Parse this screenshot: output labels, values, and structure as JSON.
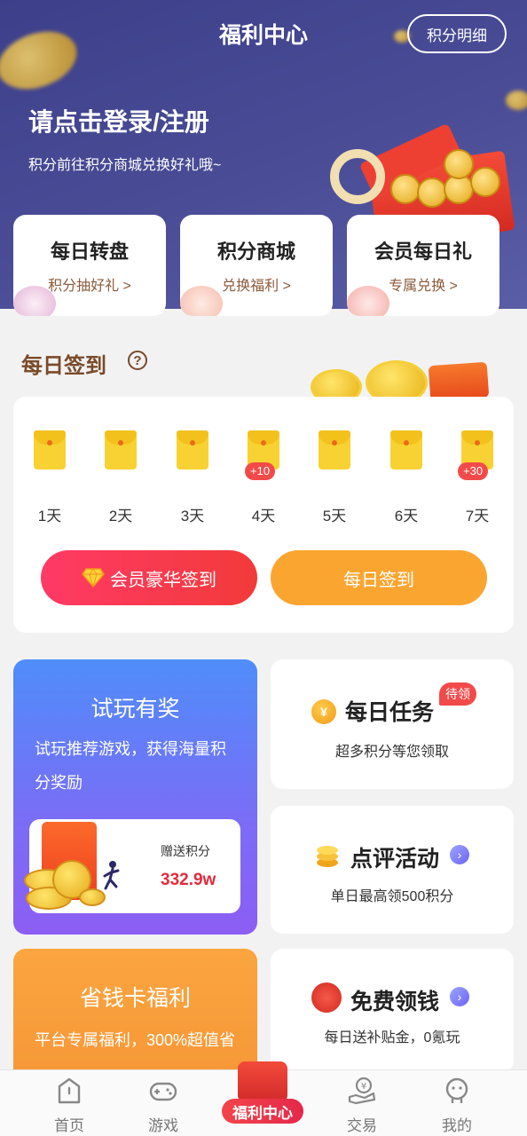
{
  "header": {
    "title": "福利中心",
    "detail_button": "积分明细"
  },
  "login": {
    "title": "请点击登录/注册",
    "subtitle": "积分前往积分商城兑换好礼哦~"
  },
  "quick_cards": [
    {
      "title": "每日转盘",
      "sub": "积分抽好礼 >"
    },
    {
      "title": "积分商城",
      "sub": "兑换福利 >"
    },
    {
      "title": "会员每日礼",
      "sub": "专属兑换 >"
    }
  ],
  "checkin": {
    "title": "每日签到",
    "days": [
      "1天",
      "2天",
      "3天",
      "4天",
      "5天",
      "6天",
      "7天"
    ],
    "bonus_day4": "+10",
    "bonus_day7": "+30",
    "vip_button": "会员豪华签到",
    "daily_button": "每日签到"
  },
  "trial": {
    "title": "试玩有奖",
    "desc": "试玩推荐游戏，获得海量积分奖励",
    "points_label": "赠送积分",
    "points_value": "332.9w"
  },
  "tasks": {
    "daily_title": "每日任务",
    "daily_badge": "待领",
    "daily_sub": "超多积分等您领取",
    "review_title": "点评活动",
    "review_sub": "单日最高领500积分",
    "money_title": "免费领钱",
    "money_sub": "每日送补贴金，0氪玩"
  },
  "save_card": {
    "title": "省钱卡福利",
    "desc": "平台专属福利，300%超值省"
  },
  "tabbar": {
    "home": "首页",
    "games": "游戏",
    "center": "福利中心",
    "trade": "交易",
    "mine": "我的"
  },
  "colors": {
    "hero": "#4a4d96",
    "vip_button": "#f23a4a",
    "daily_button": "#fba531",
    "trial_card": "#6e7bf7",
    "save_card": "#fba540",
    "accent_red": "#e52a3a"
  }
}
